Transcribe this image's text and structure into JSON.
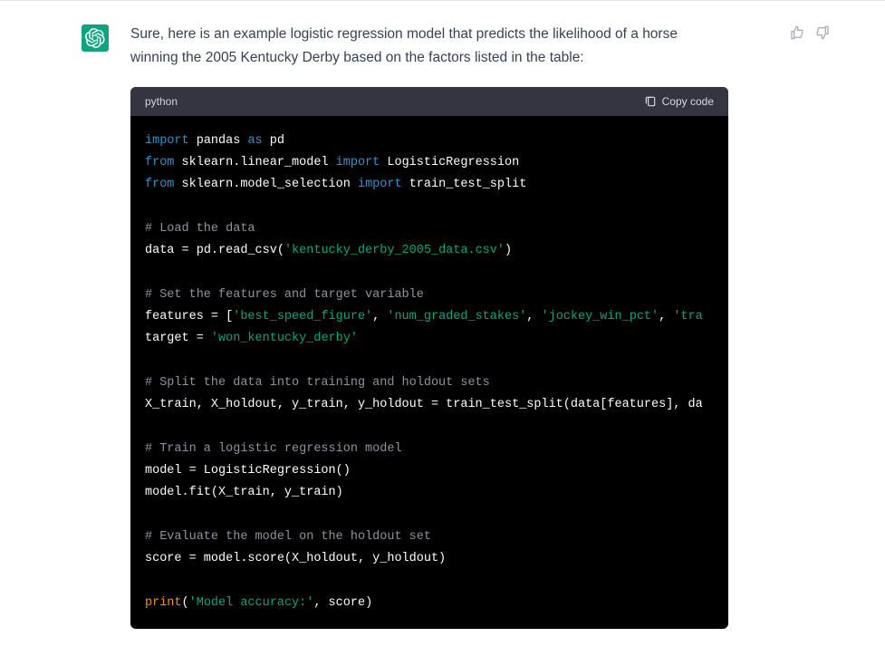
{
  "message": {
    "intro": "Sure, here is an example logistic regression model that predicts the likelihood of a horse winning the 2005 Kentucky Derby based on the factors listed in the table:"
  },
  "code": {
    "language": "python",
    "copy_label": "Copy code",
    "tokens": {
      "kw_import": "import",
      "kw_from": "from",
      "kw_as": "as",
      "mod_pandas": "pandas",
      "alias_pd": "pd",
      "mod_linear": "sklearn.linear_model",
      "cls_logreg": "LogisticRegression",
      "mod_sel": "sklearn.model_selection",
      "fn_tts": "train_test_split",
      "cmt_load": "# Load the data",
      "id_data": "data",
      "eq": " = ",
      "read_csv": "pd.read_csv(",
      "str_csv": "'kentucky_derby_2005_data.csv'",
      "rparen": ")",
      "cmt_features": "# Set the features and target variable",
      "id_features": "features",
      "lbracket": " = [",
      "str_f1": "'best_speed_figure'",
      "comma": ", ",
      "str_f2": "'num_graded_stakes'",
      "str_f3": "'jockey_win_pct'",
      "str_f4": "'tra",
      "id_target": "target",
      "str_target": "'won_kentucky_derby'",
      "cmt_split": "# Split the data into training and holdout sets",
      "split_lhs": "X_train, X_holdout, y_train, y_holdout = train_test_split(data[features], da",
      "cmt_train": "# Train a logistic regression model",
      "model_line1": "model = LogisticRegression()",
      "model_line2": "model.fit(X_train, y_train)",
      "cmt_eval": "# Evaluate the model on the holdout set",
      "score_line": "score = model.score(X_holdout, y_holdout)",
      "fn_print": "print",
      "print_open": "(",
      "str_acc": "'Model accuracy:'",
      "print_rest": ", score)"
    }
  },
  "icons": {
    "thumbs_up": "thumbs-up-icon",
    "thumbs_down": "thumbs-down-icon",
    "clipboard": "clipboard-icon",
    "avatar": "assistant-avatar"
  }
}
